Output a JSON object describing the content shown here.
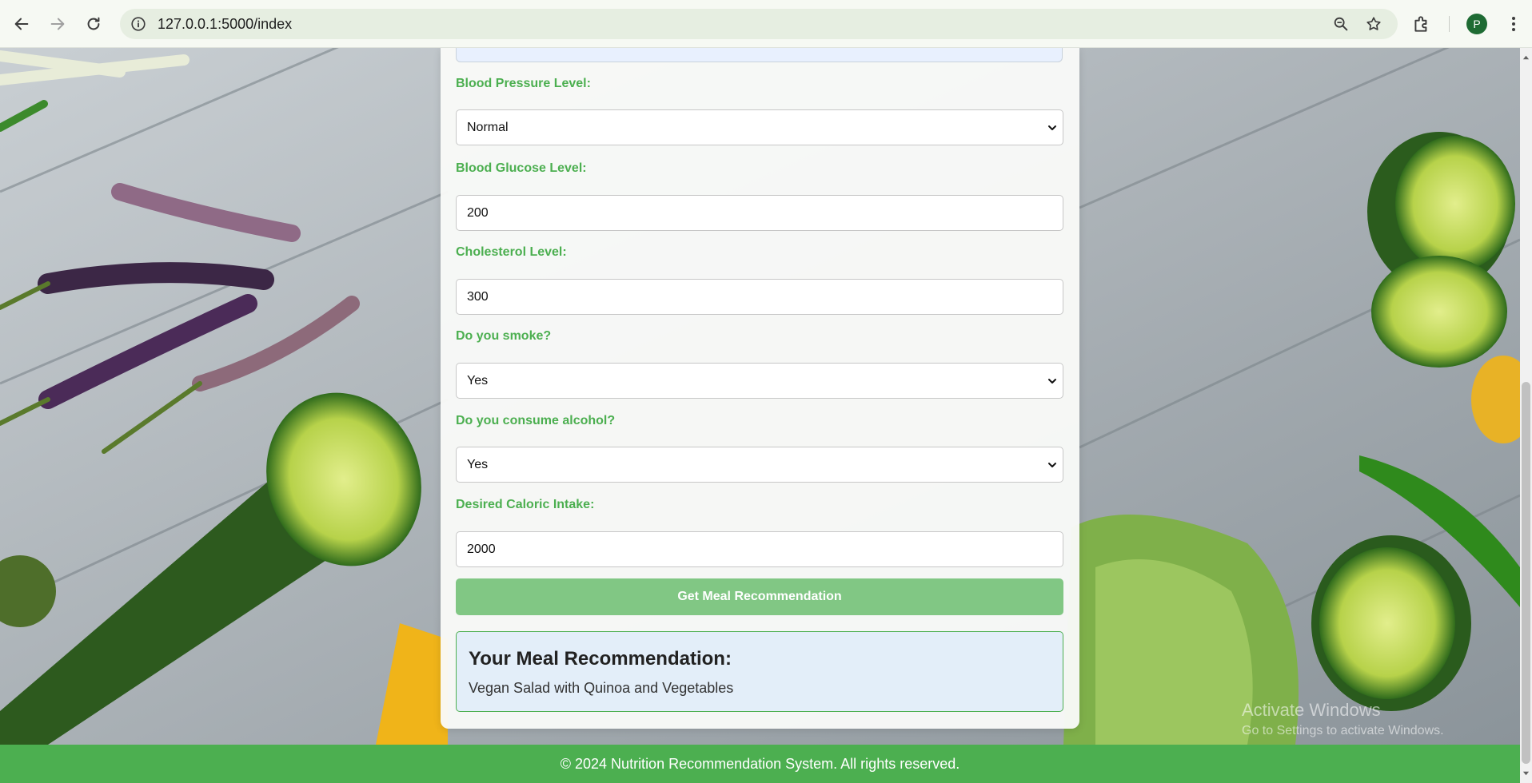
{
  "browser": {
    "url": "127.0.0.1:5000/index",
    "profile_initial": "P",
    "icons": [
      "back-icon",
      "forward-icon",
      "reload-icon",
      "site-info-icon",
      "zoom-icon",
      "bookmark-star-icon",
      "extensions-icon",
      "menu-icon"
    ]
  },
  "form": {
    "fields": [
      {
        "label": "Blood Pressure Level:",
        "value": "Normal",
        "type": "select"
      },
      {
        "label": "Blood Glucose Level:",
        "value": "200",
        "type": "input"
      },
      {
        "label": "Cholesterol Level:",
        "value": "300",
        "type": "input"
      },
      {
        "label": "Do you smoke?",
        "value": "Yes",
        "type": "select"
      },
      {
        "label": "Do you consume alcohol?",
        "value": "Yes",
        "type": "select"
      },
      {
        "label": "Desired Caloric Intake:",
        "value": "2000",
        "type": "input"
      }
    ],
    "submit_label": "Get Meal Recommendation"
  },
  "result": {
    "heading": "Your Meal Recommendation:",
    "text": "Vegan Salad with Quinoa and Vegetables"
  },
  "watermark": {
    "line1": "Activate Windows",
    "line2": "Go to Settings to activate Windows."
  },
  "footer": {
    "text": "© 2024 Nutrition Recommendation System. All rights reserved."
  },
  "colors": {
    "accent": "#4caf50",
    "button": "#81c784",
    "result_bg": "#e3eef9"
  }
}
